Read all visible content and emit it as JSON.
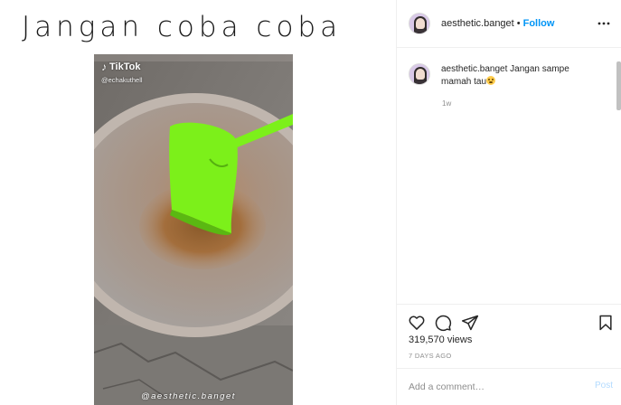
{
  "media": {
    "overlay_title": "Jangan coba coba",
    "tiktok_brand": "TikTok",
    "tiktok_user": "@echakuthell",
    "watermark": "@aesthetic.banget"
  },
  "header": {
    "username": "aesthetic.banget",
    "separator": "•",
    "follow_label": "Follow"
  },
  "caption": {
    "username": "aesthetic.banget",
    "text": "Jangan sampe mamah tau",
    "emoji": "astonished-face-emoji",
    "time": "1w"
  },
  "actions": {
    "icons": [
      "heart-icon",
      "comment-icon",
      "share-icon",
      "bookmark-icon"
    ]
  },
  "stats": {
    "views": "319,570 views",
    "posted": "7 DAYS AGO"
  },
  "comment_box": {
    "placeholder": "Add a comment…",
    "post_label": "Post"
  },
  "colors": {
    "accent": "#0095f6",
    "post_disabled": "#b3dbff",
    "spatula": "#7cf01a"
  }
}
